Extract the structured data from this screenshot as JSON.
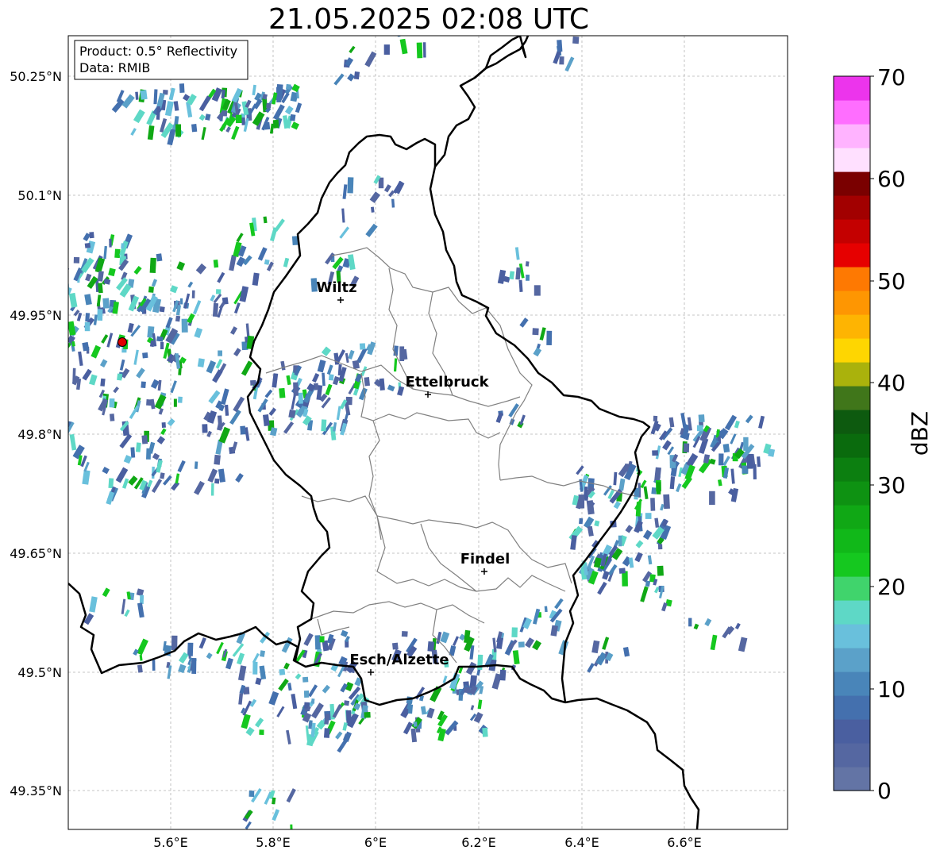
{
  "title": "21.05.2025 02:08 UTC",
  "info_box": {
    "product": "Product: 0.5° Reflectivity",
    "data": "Data: RMIB"
  },
  "axes": {
    "x_ticks": [
      "5.6°E",
      "5.8°E",
      "6°E",
      "6.2°E",
      "6.4°E",
      "6.6°E"
    ],
    "y_ticks": [
      "50.25°N",
      "50.1°N",
      "49.95°N",
      "49.8°N",
      "49.65°N",
      "49.5°N",
      "49.35°N"
    ]
  },
  "cities": [
    {
      "name": "Wiltz"
    },
    {
      "name": "Ettelbruck"
    },
    {
      "name": "Findel"
    },
    {
      "name": "Esch/Alzette"
    }
  ],
  "colorbar": {
    "label": "dBZ",
    "ticks": [
      "0",
      "10",
      "20",
      "30",
      "40",
      "50",
      "60",
      "70"
    ],
    "colors": [
      "#6374a5",
      "#5567a1",
      "#4a5fa0",
      "#4470ae",
      "#4985b9",
      "#5ba1c9",
      "#69c0dc",
      "#5ed8c6",
      "#40d46c",
      "#15c81f",
      "#11b819",
      "#10a815",
      "#0e9212",
      "#0c7f10",
      "#0a6b0d",
      "#0d5a0f",
      "#40761a",
      "#aab20c",
      "#fed601",
      "#feb402",
      "#fe9602",
      "#fe7902",
      "#e60000",
      "#c40000",
      "#a20000",
      "#7a0000",
      "#ffe0ff",
      "#ffb3ff",
      "#ff6eff",
      "#ec34ec"
    ]
  },
  "radar_site_color": "#e00000"
}
